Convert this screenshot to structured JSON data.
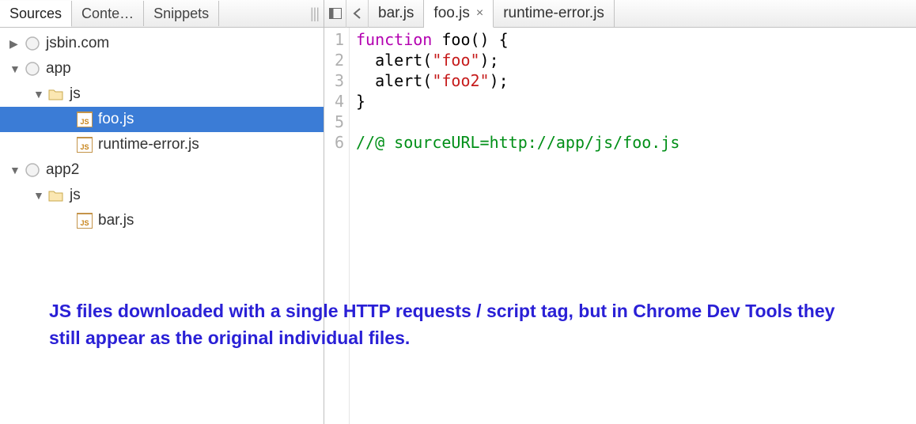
{
  "panel_tabs": {
    "sources": "Sources",
    "content": "Conte…",
    "snippets": "Snippets"
  },
  "tree": {
    "jsbin": {
      "label": "jsbin.com"
    },
    "app": {
      "label": "app"
    },
    "app_js": {
      "label": "js"
    },
    "foo": {
      "label": "foo.js"
    },
    "rte": {
      "label": "runtime-error.js"
    },
    "app2": {
      "label": "app2"
    },
    "app2_js": {
      "label": "js"
    },
    "bar": {
      "label": "bar.js"
    }
  },
  "file_tabs": {
    "bar": "bar.js",
    "foo": "foo.js",
    "rte": "runtime-error.js"
  },
  "code": {
    "lines": [
      "1",
      "2",
      "3",
      "4",
      "5",
      "6"
    ],
    "l1_kw": "function",
    "l1_rest": " foo() {",
    "l2_pre": "  alert(",
    "l2_str": "\"foo\"",
    "l2_post": ");",
    "l3_pre": "  alert(",
    "l3_str": "\"foo2\"",
    "l3_post": ");",
    "l4": "}",
    "l5": "",
    "l6_cmt": "//@ sourceURL=http://app/js/foo.js"
  },
  "annotation": "JS files downloaded with a single HTTP requests / script tag, but in Chrome Dev Tools they still appear as the original individual files."
}
